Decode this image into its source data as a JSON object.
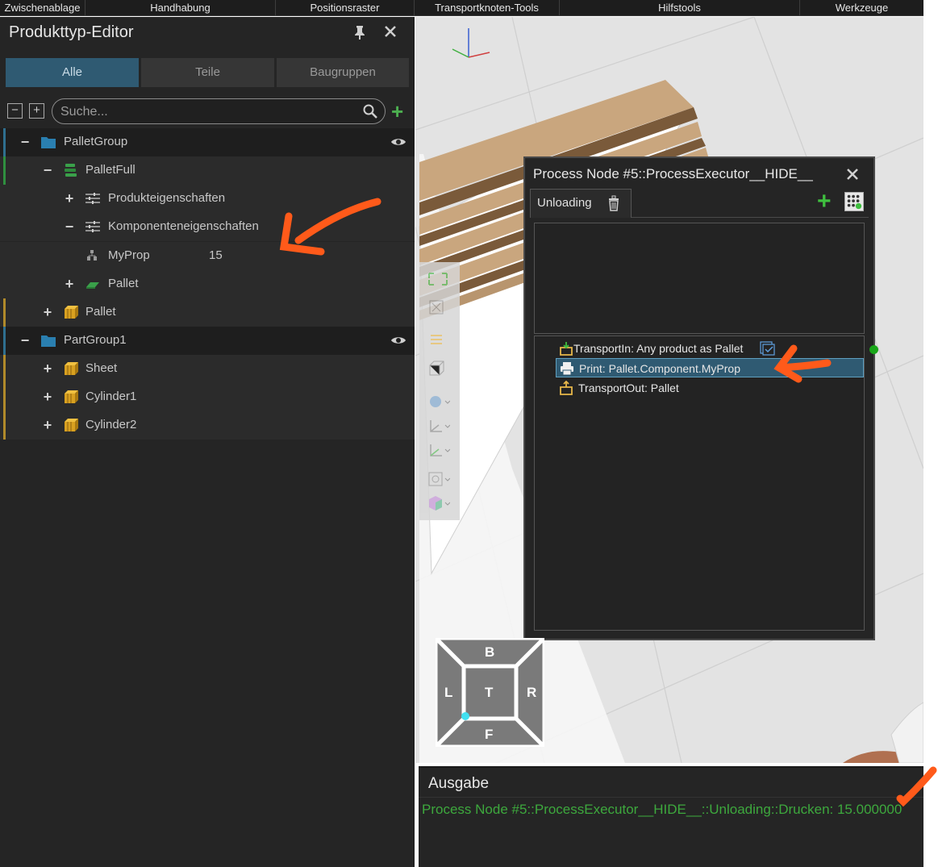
{
  "ribbon": {
    "groups": [
      "Zwischenablage",
      "Handhabung",
      "Positionsraster",
      "Transportknoten-Tools",
      "Hilfstools",
      "Werkzeuge"
    ]
  },
  "left_panel": {
    "title": "Produkttyp-Editor",
    "tabs": [
      {
        "label": "Alle",
        "active": true
      },
      {
        "label": "Teile",
        "active": false
      },
      {
        "label": "Baugruppen",
        "active": false
      }
    ],
    "search_placeholder": "Suche...",
    "tree": [
      {
        "label": "PalletGroup",
        "toggle": "−",
        "icon": "folder-icon",
        "eye": true
      },
      {
        "label": "PalletFull",
        "toggle": "−",
        "icon": "stack-icon"
      },
      {
        "label": "Produkteigenschaften",
        "toggle": "+",
        "icon": "properties-icon"
      },
      {
        "label": "Komponenteneigenschaften",
        "toggle": "−",
        "icon": "properties-icon"
      },
      {
        "label": "MyProp",
        "value": "15",
        "icon": "property-item-icon"
      },
      {
        "label": "Pallet",
        "toggle": "+",
        "icon": "pallet-icon"
      },
      {
        "label": "Pallet",
        "toggle": "+",
        "icon": "part-icon"
      },
      {
        "label": "PartGroup1",
        "toggle": "−",
        "icon": "folder-icon",
        "eye": true
      },
      {
        "label": "Sheet",
        "toggle": "+",
        "icon": "part-icon"
      },
      {
        "label": "Cylinder1",
        "toggle": "+",
        "icon": "part-icon"
      },
      {
        "label": "Cylinder2",
        "toggle": "+",
        "icon": "part-icon"
      }
    ]
  },
  "process_dialog": {
    "title": "Process Node #5::ProcessExecutor__HIDE__",
    "tab_label": "Unloading",
    "items": [
      {
        "label": "TransportIn: Any product as Pallet",
        "icon": "transport-in-icon",
        "selected": false
      },
      {
        "label": "Print: Pallet.Component.MyProp",
        "icon": "print-icon",
        "selected": true
      },
      {
        "label": "TransportOut: Pallet",
        "icon": "transport-out-icon",
        "selected": false
      }
    ]
  },
  "viewcube": {
    "top": "B",
    "left": "L",
    "center": "T",
    "right": "R",
    "bottom": "F"
  },
  "output": {
    "title": "Ausgabe",
    "line": "Process Node #5::ProcessExecutor__HIDE__::Unloading::Drucken: 15.000000"
  },
  "colors": {
    "accent": "#2f5a72",
    "output_text": "#3da83d",
    "annotation": "#ff5a1a"
  }
}
